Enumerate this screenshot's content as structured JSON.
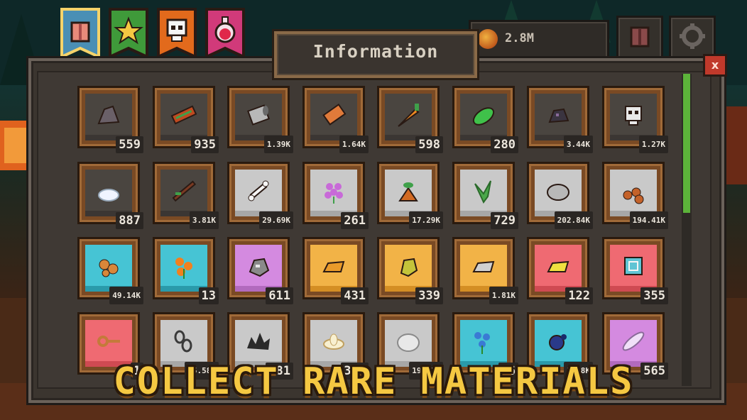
{
  "header": {
    "tabs": [
      {
        "icon": "inventory-icon",
        "color": "#4a8fb5",
        "active": true
      },
      {
        "icon": "star-icon",
        "color": "#3f9a3a",
        "active": false
      },
      {
        "icon": "skull-icon",
        "color": "#e26a1c",
        "active": false
      },
      {
        "icon": "potion-icon",
        "color": "#d13a7a",
        "active": false
      }
    ],
    "coins": "2.8M"
  },
  "panel": {
    "title": "Information",
    "close_label": "x"
  },
  "items": [
    {
      "icon": "rock-icon",
      "count": "559",
      "bg": "#4a4540",
      "shade": "#3b3633",
      "fg": "#6a6068"
    },
    {
      "icon": "log-icon",
      "count": "935",
      "bg": "#4a4540",
      "shade": "#3b3633",
      "fg": "#c04a20"
    },
    {
      "icon": "metal-can-icon",
      "count": "1.39K",
      "bg": "#4a4540",
      "shade": "#3b3633",
      "fg": "#b8b8b8"
    },
    {
      "icon": "tag-icon",
      "count": "1.64K",
      "bg": "#4a4540",
      "shade": "#3b3633",
      "fg": "#e07a3a"
    },
    {
      "icon": "carrot-icon",
      "count": "598",
      "bg": "#4a4540",
      "shade": "#3b3633",
      "fg": "#ef8a22"
    },
    {
      "icon": "leaf-icon",
      "count": "280",
      "bg": "#4a4540",
      "shade": "#3b3633",
      "fg": "#3fc14a"
    },
    {
      "icon": "coal-icon",
      "count": "3.44K",
      "bg": "#4a4540",
      "shade": "#3b3633",
      "fg": "#3a3440"
    },
    {
      "icon": "skull-icon",
      "count": "1.27K",
      "bg": "#4a4540",
      "shade": "#3b3633",
      "fg": "#e8e8e8"
    },
    {
      "icon": "snow-icon",
      "count": "887",
      "bg": "#4a4540",
      "shade": "#3b3633",
      "fg": "#f0f4ff"
    },
    {
      "icon": "stick-icon",
      "count": "3.81K",
      "bg": "#4a4540",
      "shade": "#3b3633",
      "fg": "#7a3a22"
    },
    {
      "icon": "bone-icon",
      "count": "29.69K",
      "bg": "#c9c9c9",
      "shade": "#a7a7a7",
      "fg": "#f5f5f5"
    },
    {
      "icon": "flower-icon",
      "count": "261",
      "bg": "#c9c9c9",
      "shade": "#a7a7a7",
      "fg": "#c86ad8"
    },
    {
      "icon": "sprout-icon",
      "count": "17.29K",
      "bg": "#c9c9c9",
      "shade": "#a7a7a7",
      "fg": "#d26a22"
    },
    {
      "icon": "herb-icon",
      "count": "729",
      "bg": "#c9c9c9",
      "shade": "#a7a7a7",
      "fg": "#4aa84a"
    },
    {
      "icon": "stone-icon",
      "count": "202.84K",
      "bg": "#c9c9c9",
      "shade": "#a7a7a7",
      "fg": "#b8b8b8"
    },
    {
      "icon": "firewood-icon",
      "count": "194.41K",
      "bg": "#c9c9c9",
      "shade": "#a7a7a7",
      "fg": "#c4622a"
    },
    {
      "icon": "ore-icon",
      "count": "49.14K",
      "bg": "#46c4d4",
      "shade": "#2a9aaa",
      "fg": "#d8873a"
    },
    {
      "icon": "orange-flower-icon",
      "count": "13",
      "bg": "#46c4d4",
      "shade": "#2a9aaa",
      "fg": "#f2801e"
    },
    {
      "icon": "silver-ore-icon",
      "count": "611",
      "bg": "#d48ae0",
      "shade": "#b26abe",
      "fg": "#8a8a8a"
    },
    {
      "icon": "gold-bar-icon",
      "count": "431",
      "bg": "#f2b347",
      "shade": "#d48e24",
      "fg": "#e99a2a"
    },
    {
      "icon": "gold-nugget-icon",
      "count": "339",
      "bg": "#f2b347",
      "shade": "#d48e24",
      "fg": "#c4c43a"
    },
    {
      "icon": "iron-bar-icon",
      "count": "1.81K",
      "bg": "#f2b347",
      "shade": "#d48e24",
      "fg": "#d0d0d0"
    },
    {
      "icon": "yellow-bar-icon",
      "count": "122",
      "bg": "#ef6a72",
      "shade": "#cf4a52",
      "fg": "#f0e040"
    },
    {
      "icon": "rune-stone-icon",
      "count": "355",
      "bg": "#ef6a72",
      "shade": "#cf4a52",
      "fg": "#5fc4d4"
    },
    {
      "icon": "key-icon",
      "count": "1",
      "bg": "#ef6a72",
      "shade": "#cf4a52",
      "fg": "#c47a3a"
    },
    {
      "icon": "chain-icon",
      "count": "15.58K",
      "bg": "#c9c9c9",
      "shade": "#a7a7a7",
      "fg": "#3a3a3a"
    },
    {
      "icon": "dark-bush-icon",
      "count": "381",
      "bg": "#c9c9c9",
      "shade": "#a7a7a7",
      "fg": "#2a2a2a"
    },
    {
      "icon": "lotus-icon",
      "count": "361",
      "bg": "#c9c9c9",
      "shade": "#a7a7a7",
      "fg": "#f8f0d0"
    },
    {
      "icon": "plate-icon",
      "count": "19.85K",
      "bg": "#c9c9c9",
      "shade": "#a7a7a7",
      "fg": "#e8e8e8"
    },
    {
      "icon": "blue-flower-icon",
      "count": "86",
      "bg": "#46c4d4",
      "shade": "#2a9aaa",
      "fg": "#3a7ad4"
    },
    {
      "icon": "berry-icon",
      "count": "1.38K",
      "bg": "#46c4d4",
      "shade": "#2a9aaa",
      "fg": "#2a3a8a"
    },
    {
      "icon": "feather-icon",
      "count": "565",
      "bg": "#d48ae0",
      "shade": "#b26abe",
      "fg": "#f0e0f8"
    }
  ],
  "banner": "COLLECT RARE MATERIALS"
}
